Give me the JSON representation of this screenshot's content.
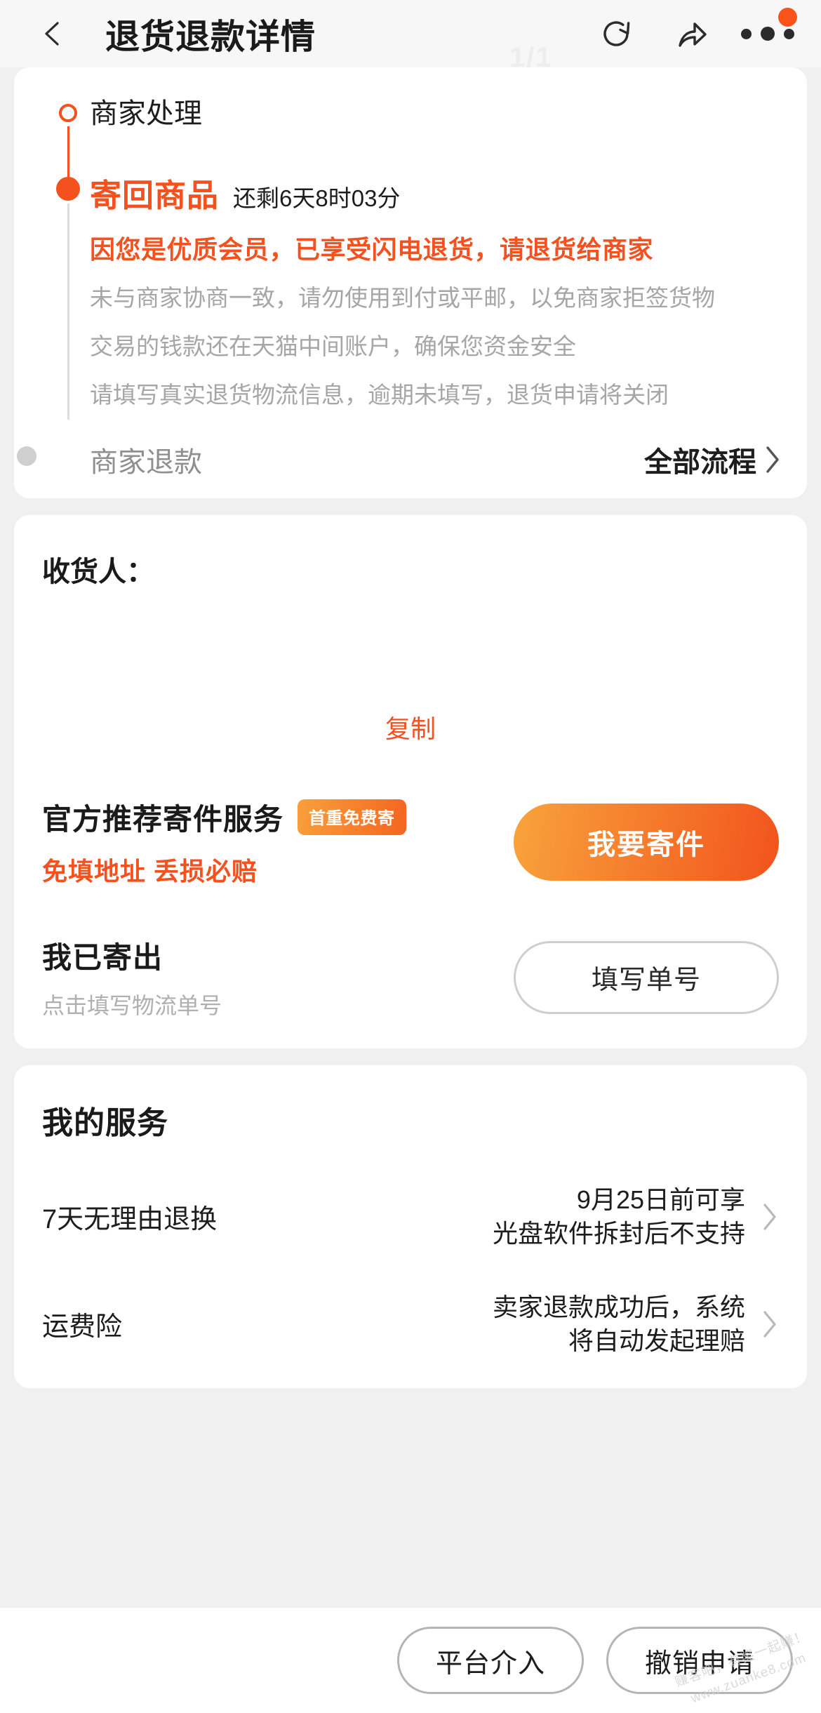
{
  "header": {
    "back_icon": "back-arrow-icon",
    "title": "退货退款详情",
    "refresh_icon": "refresh-icon",
    "share_icon": "share-icon",
    "more_icon": "more-dots-icon",
    "ghost_text": "1/1"
  },
  "timeline": {
    "step1": {
      "label": "商家处理"
    },
    "step2": {
      "label": "寄回商品",
      "countdown": "还剩6天8时03分",
      "highlight": "因您是优质会员，已享受闪电退货，请退货给商家",
      "notes": [
        "未与商家协商一致，请勿使用到付或平邮，以免商家拒签货物",
        "交易的钱款还在天猫中间账户，确保您资金安全",
        "请填写真实退货物流信息，逾期未填写，退货申请将关闭"
      ]
    },
    "step3": {
      "label": "商家退款"
    },
    "all_flow": "全部流程"
  },
  "address": {
    "recipient_label": "收货人：",
    "recipient_value": "",
    "copy_label": "复制"
  },
  "shipping": {
    "official_title": "官方推荐寄件服务",
    "official_badge": "首重免费寄",
    "official_sub": "免填地址 丢损必赔",
    "official_button": "我要寄件",
    "sent_title": "我已寄出",
    "sent_sub": "点击填写物流单号",
    "sent_button": "填写单号"
  },
  "services": {
    "heading": "我的服务",
    "items": [
      {
        "name": "7天无理由退换",
        "value_line1": "9月25日前可享",
        "value_line2": "光盘软件拆封后不支持"
      },
      {
        "name": "运费险",
        "value_line1": "卖家退款成功后，系统",
        "value_line2": "将自动发起理赔"
      }
    ]
  },
  "bottom_bar": {
    "platform_button": "平台介入",
    "cancel_button": "撤销申请"
  },
  "watermark": {
    "line1": "赚客吧，有奖一起赚！",
    "line2": "www.zuanke8.com"
  },
  "colors": {
    "accent_orange": "#f4511e",
    "badge_orange": "#fa541c",
    "page_bg": "#f0f0f0",
    "card_bg": "#ffffff",
    "muted_gray": "#a6a6a6"
  }
}
